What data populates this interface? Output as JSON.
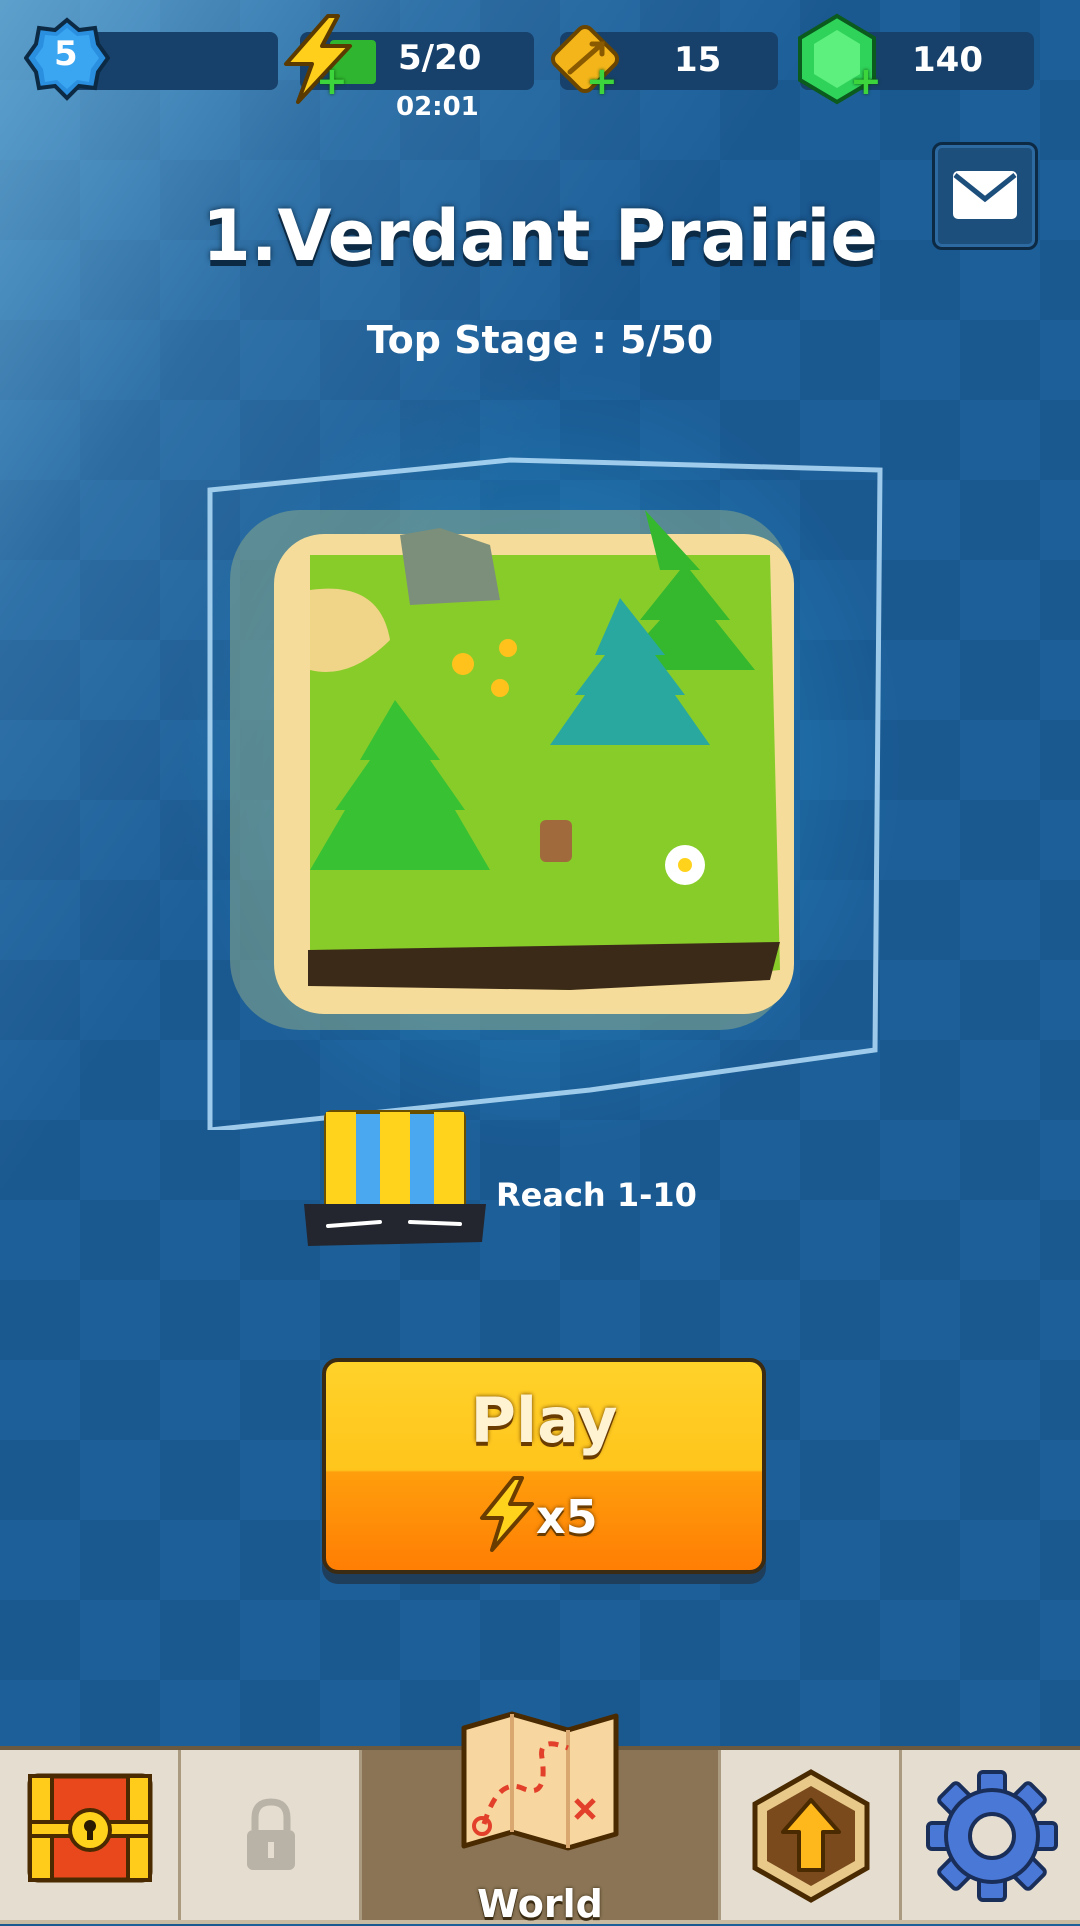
{
  "top_bar": {
    "level": "5",
    "energy": {
      "value": "5/20",
      "timer": "02:01"
    },
    "arrows": "15",
    "gems": "140"
  },
  "stage": {
    "title": "1.Verdant Prairie",
    "top_stage": "Top Stage : 5/50"
  },
  "reward": {
    "label": "Reach 1-10"
  },
  "play": {
    "label": "Play",
    "cost": "x5"
  },
  "nav": {
    "world_label": "World"
  },
  "colors": {
    "accent_orange": "#ff9e0c",
    "accent_yellow": "#ffd22a",
    "background_blue": "#1d5f99"
  },
  "icons": [
    "level-badge-icon",
    "energy-icon",
    "arrow-ticket-icon",
    "gem-icon",
    "mail-icon",
    "chest-icon",
    "lock-icon",
    "map-icon",
    "upgrade-icon",
    "settings-icon"
  ]
}
